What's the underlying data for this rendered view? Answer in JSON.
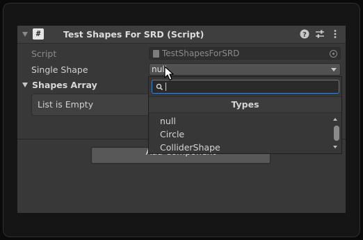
{
  "component": {
    "title": "Test Shapes For SRD (Script)",
    "script_label": "Script",
    "script_value": "TestShapesForSRD",
    "single_shape_label": "Single Shape",
    "single_shape_value": "null",
    "shapes_array_label": "Shapes Array",
    "list_empty_text": "List is Empty",
    "add_component_label": "Add Component"
  },
  "type_popup": {
    "search_value": "",
    "header": "Types",
    "items": [
      "null",
      "Circle",
      "ColliderShape"
    ]
  },
  "icons": {
    "script": "csharp-script-icon",
    "help": "help-icon",
    "presets": "presets-sliders-icon",
    "more": "more-vertical-icon",
    "search": "search-icon"
  },
  "colors": {
    "panel_bg": "#383838",
    "focus_outline": "#3d7fc9"
  }
}
